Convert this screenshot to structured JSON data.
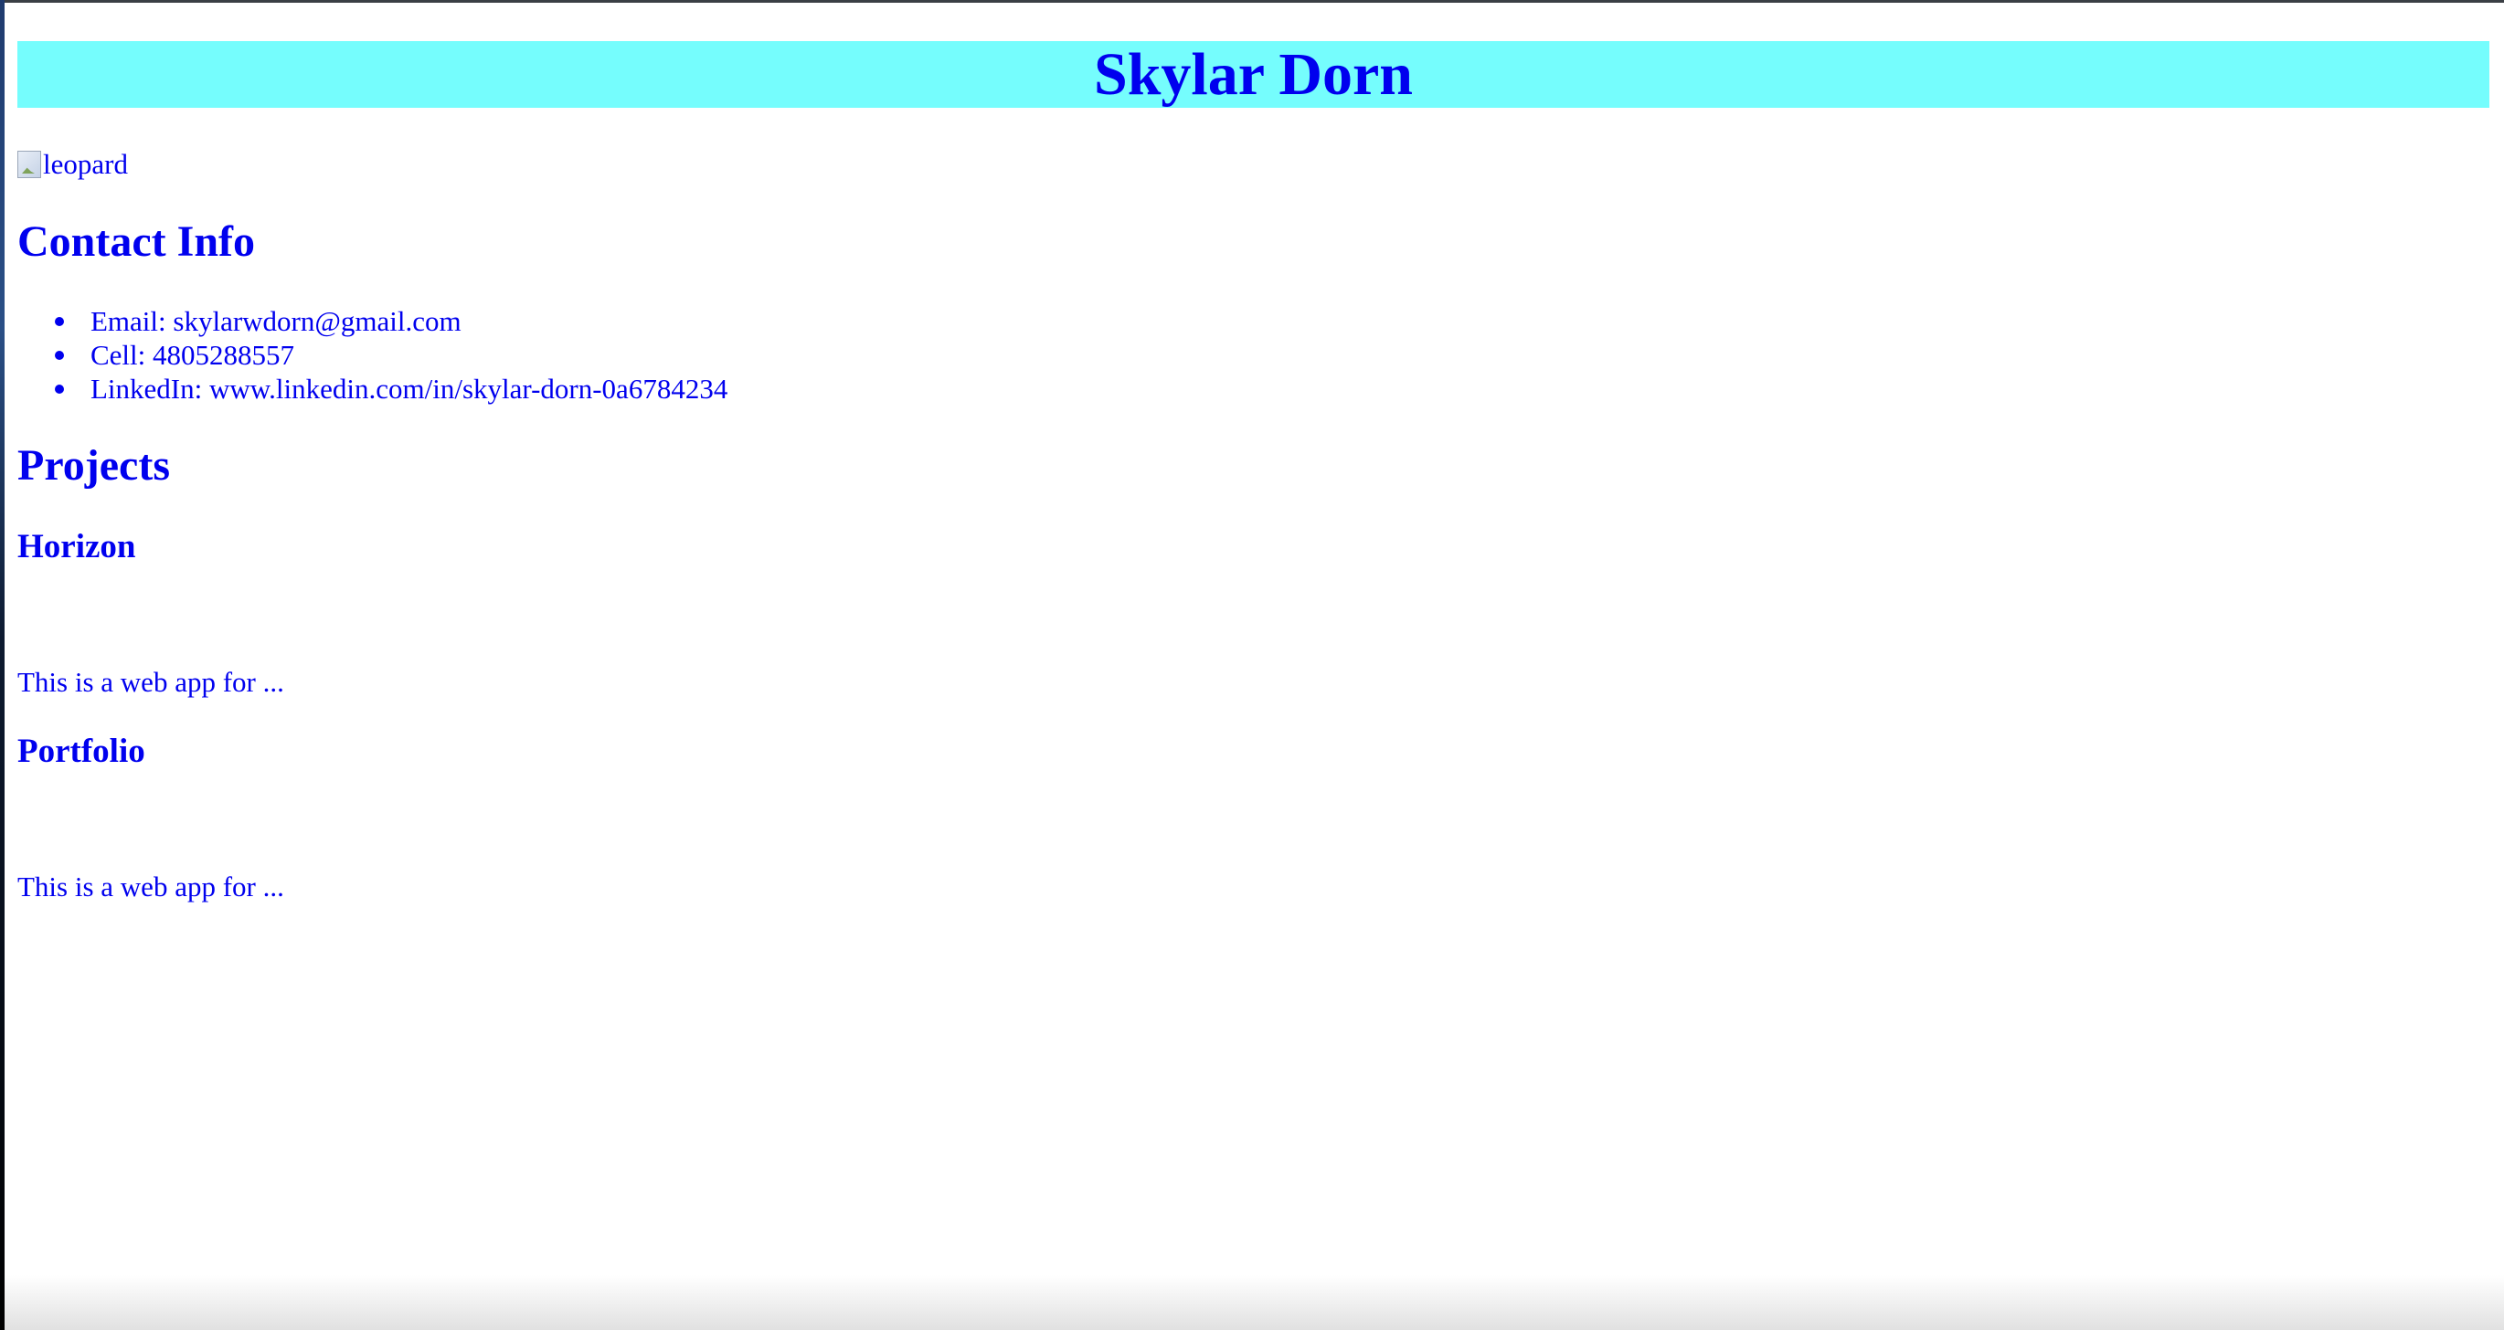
{
  "header": {
    "title": "Skylar Dorn"
  },
  "profile_image": {
    "alt": "leopard"
  },
  "contact": {
    "heading": "Contact Info",
    "items": [
      "Email: skylarwdorn@gmail.com",
      "Cell: 4805288557",
      "LinkedIn: www.linkedin.com/in/skylar-dorn-0a6784234"
    ]
  },
  "projects": {
    "heading": "Projects",
    "items": [
      {
        "name": "Horizon",
        "description": "This is a web app for ..."
      },
      {
        "name": "Portfolio",
        "description": "This is a web app for ..."
      }
    ]
  },
  "colors": {
    "text": "#0000ee",
    "title_background": "#75fdfd",
    "page_background": "#ffffff"
  },
  "icons": {
    "broken_image": "broken-image-icon"
  }
}
